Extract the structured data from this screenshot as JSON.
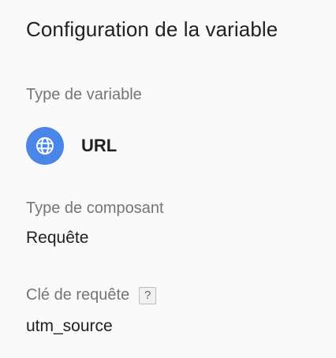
{
  "config": {
    "title": "Configuration de la variable",
    "variable_type_label": "Type de variable",
    "variable_type": {
      "name": "URL",
      "icon": "globe-icon",
      "icon_color": "#4a86e8"
    },
    "component_type_label": "Type de composant",
    "component_type_value": "Requête",
    "query_key_label": "Clé de requête",
    "query_key_help": "?",
    "query_key_value": "utm_source"
  }
}
